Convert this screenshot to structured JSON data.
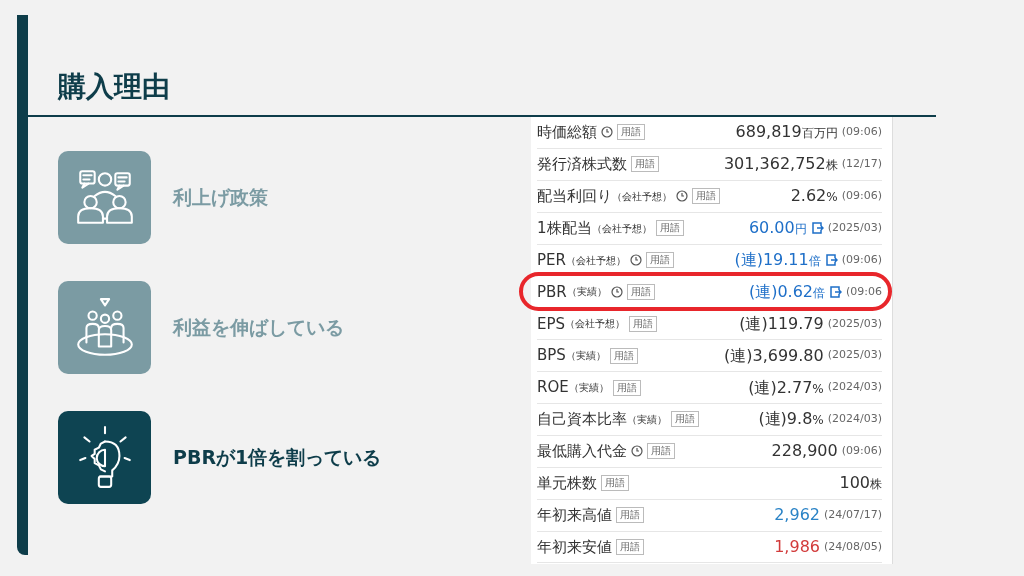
{
  "title": "購入理由",
  "reasons": [
    {
      "label": "利上げ政策",
      "kind": "meeting",
      "selected": false
    },
    {
      "label": "利益を伸ばしている",
      "kind": "team",
      "selected": false
    },
    {
      "label": "PBRが1倍を割っている",
      "kind": "idea",
      "selected": true
    }
  ],
  "stock_table": {
    "rows": [
      {
        "label": "時価総額",
        "clock": true,
        "tag": "用語",
        "value": "689,819",
        "unit": "百万円",
        "link": false,
        "date": "(09:06)",
        "color": "#333333",
        "highlighted": false
      },
      {
        "label": "発行済株式数",
        "clock": false,
        "tag": "用語",
        "value": "301,362,752",
        "unit": "株",
        "link": false,
        "date": "(12/17)",
        "color": "#333333",
        "highlighted": false
      },
      {
        "label": "配当利回り",
        "qualifier": "（会社予想）",
        "clock": true,
        "tag": "用語",
        "value": "2.62",
        "unit": "%",
        "link": false,
        "date": "(09:06)",
        "color": "#333333",
        "highlighted": false
      },
      {
        "label": "1株配当",
        "qualifier": "（会社予想）",
        "clock": false,
        "tag": "用語",
        "value": "60.00",
        "unit": "円",
        "link": true,
        "date": "(2025/03)",
        "color": "#1e6fc8",
        "highlighted": false
      },
      {
        "label": "PER",
        "qualifier": "（会社予想）",
        "clock": true,
        "tag": "用語",
        "prefix": "(連)",
        "value": "19.11",
        "unit": "倍",
        "link": true,
        "date": "(09:06)",
        "color": "#1e6fc8",
        "highlighted": false
      },
      {
        "label": "PBR",
        "qualifier": "（実績）",
        "clock": true,
        "tag": "用語",
        "prefix": "(連)",
        "value": "0.62",
        "unit": "倍",
        "link": true,
        "date": "(09:06",
        "color": "#1e6fc8",
        "highlighted": true
      },
      {
        "label": "EPS",
        "qualifier": "（会社予想）",
        "clock": false,
        "tag": "用語",
        "prefix": "(連)",
        "value": "119.79",
        "link": false,
        "date": "(2025/03)",
        "color": "#333333",
        "highlighted": false
      },
      {
        "label": "BPS",
        "qualifier": "（実績）",
        "clock": false,
        "tag": "用語",
        "prefix": "(連)",
        "value": "3,699.80",
        "link": false,
        "date": "(2025/03)",
        "color": "#333333",
        "highlighted": false
      },
      {
        "label": "ROE",
        "qualifier": "（実績）",
        "clock": false,
        "tag": "用語",
        "prefix": "(連)",
        "value": "2.77",
        "unit": "%",
        "link": false,
        "date": "(2024/03)",
        "color": "#333333",
        "highlighted": false
      },
      {
        "label": "自己資本比率",
        "qualifier": "（実績）",
        "clock": false,
        "tag": "用語",
        "prefix": "(連)",
        "value": "9.8",
        "unit": "%",
        "link": false,
        "date": "(2024/03)",
        "color": "#333333",
        "highlighted": false
      },
      {
        "label": "最低購入代金",
        "clock": true,
        "tag": "用語",
        "value": "228,900",
        "link": false,
        "date": "(09:06)",
        "color": "#333333",
        "highlighted": false
      },
      {
        "label": "単元株数",
        "clock": false,
        "tag": "用語",
        "value": "100",
        "unit": "株",
        "link": false,
        "color": "#333333",
        "highlighted": false
      },
      {
        "label": "年初来高値",
        "clock": false,
        "tag": "用語",
        "value": "2,962",
        "link": false,
        "date": "(24/07/17)",
        "color": "#2a83c6",
        "highlighted": false
      },
      {
        "label": "年初来安値",
        "clock": false,
        "tag": "用語",
        "value": "1,986",
        "link": false,
        "date": "(24/08/05)",
        "color": "#d23b3b",
        "highlighted": false
      }
    ]
  }
}
